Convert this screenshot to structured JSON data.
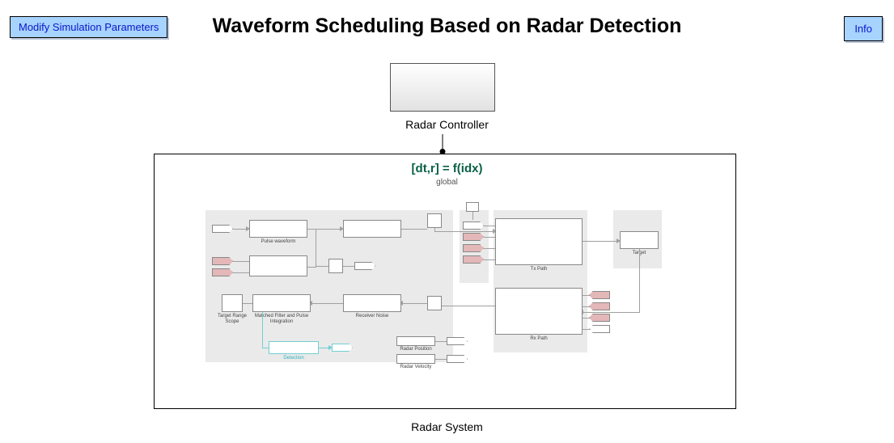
{
  "header": {
    "title": "Waveform Scheduling Based on Radar Detection",
    "modify_btn": "Modify Simulation Parameters",
    "info_btn": "Info"
  },
  "controller": {
    "label": "Radar Controller"
  },
  "radar_system": {
    "label": "Radar System",
    "fn": "[dt,r] = f(idx)",
    "scope": "global",
    "blocks": {
      "pulse_waveform": "Pulse waveform",
      "tx_path": "Tx Path",
      "target": "Target",
      "rx_path": "Rx Path",
      "receiver_noise": "Receiver Noise",
      "matched_filter": "Matched Filter and\nPulse Integration",
      "target_range_scope": "Target Range\nScope",
      "detection": "Detection",
      "radar_position": "Radar Position",
      "radar_velocity": "Radar Velocity"
    }
  }
}
